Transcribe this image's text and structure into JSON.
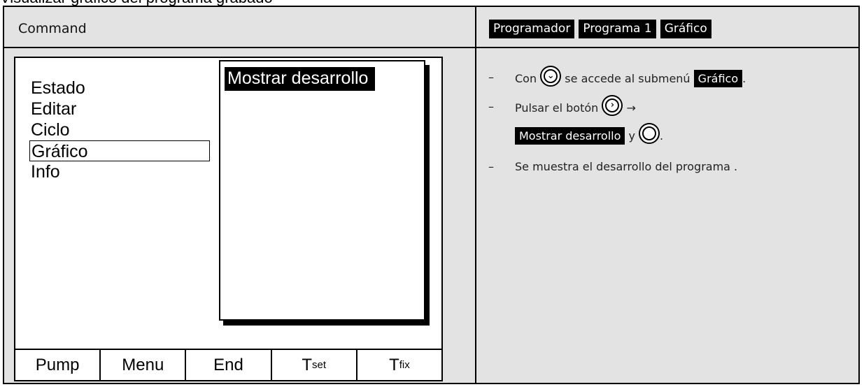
{
  "caption": "Visualizar gráfico del programa grabado",
  "header": {
    "command_title": "Command",
    "breadcrumb": [
      "Programador",
      "Programa 1",
      "Gráfico"
    ]
  },
  "device": {
    "menu_items": [
      "Estado",
      "Editar",
      "Ciclo",
      "Gráfico",
      "Info"
    ],
    "selected_menu": "Gráfico",
    "submenu_item": "Mostrar desarrollo",
    "softkeys": {
      "pump": "Pump",
      "menu": "Menu",
      "end": "End",
      "tset_main": "T",
      "tset_sub": "set",
      "tfix_main": "T",
      "tfix_sub": "fix"
    }
  },
  "instructions": {
    "dash": "–",
    "step1_pre": "Con",
    "step1_mid": "se accede al submenú",
    "step1_hl": "Gráfico",
    "step1_post": ".",
    "step2_pre": "Pulsar el botón",
    "step2_arrow": "→",
    "step2_hl": "Mostrar desarrollo",
    "step2_y": "y",
    "step2_post": ".",
    "step3": "Se muestra el desarrollo del programa ."
  },
  "icons": {
    "down_button": "chevron-down-circle-icon",
    "right_button": "chevron-right-circle-icon",
    "ok_button": "ok-circle-icon"
  },
  "colors": {
    "panel_bg": "#e3e3e3",
    "highlight_bg": "#000000",
    "highlight_fg": "#ffffff"
  }
}
